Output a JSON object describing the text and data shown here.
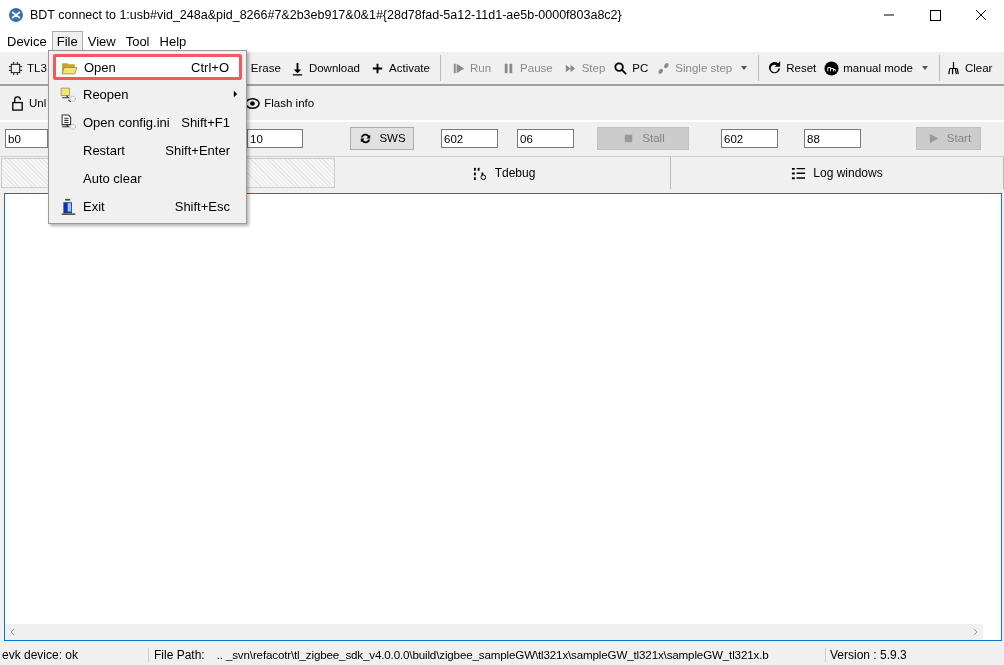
{
  "window": {
    "title": "BDT connect to 1:usb#vid_248a&pid_8266#7&2b3eb917&0&1#{28d78fad-5a12-11d1-ae5b-0000f803a8c2}"
  },
  "menu_bar": [
    {
      "label": "Device",
      "selected": false
    },
    {
      "label": "File",
      "selected": true
    },
    {
      "label": "View",
      "selected": false
    },
    {
      "label": "Tool",
      "selected": false
    },
    {
      "label": "Help",
      "selected": false
    }
  ],
  "file_menu": [
    {
      "label": "Open",
      "shortcut": "Ctrl+O",
      "selected": true,
      "submenu": false
    },
    {
      "label": "Reopen",
      "selected": false,
      "submenu": true
    },
    {
      "label": "Open config.ini",
      "shortcut": "Shift+F1",
      "selected": false,
      "submenu": false
    },
    {
      "label": "Restart",
      "shortcut": "Shift+Enter",
      "selected": false,
      "submenu": false
    },
    {
      "label": "Auto clear",
      "selected": false,
      "submenu": false
    },
    {
      "label": "Exit",
      "shortcut": "Shift+Esc",
      "selected": false,
      "submenu": false
    }
  ],
  "toolbar": [
    {
      "label": "TL3",
      "disabled": false,
      "dropdown": false
    },
    {
      "label": "Erase",
      "disabled": false,
      "dropdown": false
    },
    {
      "label": "Download",
      "disabled": false,
      "dropdown": false
    },
    {
      "label": "Activate",
      "disabled": false,
      "dropdown": false
    },
    {
      "label": "Run",
      "disabled": true,
      "dropdown": false
    },
    {
      "label": "Pause",
      "disabled": true,
      "dropdown": false
    },
    {
      "label": "Step",
      "disabled": true,
      "dropdown": false
    },
    {
      "label": "PC",
      "disabled": false,
      "dropdown": false
    },
    {
      "label": "Single step",
      "disabled": true,
      "dropdown": true
    },
    {
      "label": "Reset",
      "disabled": false,
      "dropdown": false
    },
    {
      "label": "manual mode",
      "disabled": false,
      "dropdown": true
    },
    {
      "label": "Clear",
      "disabled": false,
      "dropdown": false
    }
  ],
  "toolbar2": [
    {
      "label": "Unl"
    },
    {
      "label": "Flash info"
    }
  ],
  "controls": [
    {
      "kind": "field",
      "value": "b0"
    },
    {
      "kind": "field",
      "value": "10"
    },
    {
      "kind": "button",
      "label": "SWS",
      "disabled": false
    },
    {
      "kind": "field",
      "value": "602"
    },
    {
      "kind": "field",
      "value": "06"
    },
    {
      "kind": "button",
      "label": "Stall",
      "disabled": true
    },
    {
      "kind": "field",
      "value": "602"
    },
    {
      "kind": "field",
      "value": "88"
    },
    {
      "kind": "button",
      "label": "Start",
      "disabled": true
    }
  ],
  "tabs": [
    {
      "selected": true
    },
    {
      "label": "Tdebug",
      "selected": false
    },
    {
      "label": "Log windows",
      "selected": false
    }
  ],
  "status_bar": {
    "device": "evk device: ok",
    "path_label": "File Path:",
    "path": ".. _svn\\refacotr\\tl_zigbee_sdk_v4.0.0.0\\build\\zigbee_sampleGW\\tl321x\\sampleGW_tl321x\\sampleGW_tl321x.b",
    "version": "Version : 5.9.3"
  }
}
